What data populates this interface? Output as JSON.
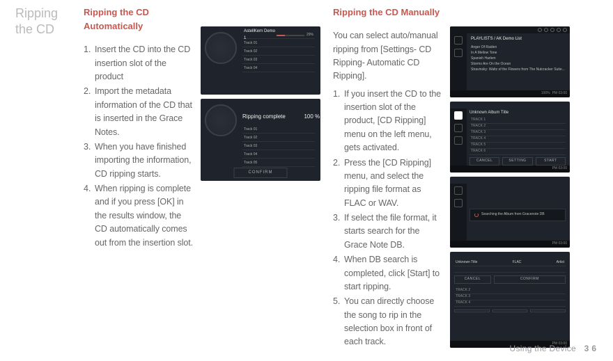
{
  "sidebar_title_line1": "Ripping",
  "sidebar_title_line2": "the CD",
  "auto": {
    "heading": "Ripping the CD Automatically",
    "steps": [
      "Insert the CD into the CD insertion slot of the product",
      "Import the metadata information of the CD that is inserted in the Grace Notes.",
      "When you have finished importing the information, CD ripping starts.",
      "When ripping is complete and if you press [OK] in the results window, the CD automatically comes out from the insertion slot."
    ]
  },
  "manual": {
    "heading": "Ripping the CD Manually",
    "intro": "You can select auto/manual ripping from [Settings- CD Ripping- Automatic CD Ripping].",
    "steps": [
      "If you insert the CD to the insertion slot of the product, [CD Ripping] menu on the left menu, gets activated.",
      "Press the [CD Ripping] menu, and select the ripping file format as FLAC or WAV.",
      "If select the file format, it starts search for the Grace Note DB.",
      "When DB search is completed, click [Start] to start ripping.",
      "You can directly choose the song to rip in the selection box in front of each track."
    ]
  },
  "figures": {
    "auto1": {
      "album_label": "AstellKern Demo 1",
      "progress_pct": "29%",
      "tracks": [
        "Track 01",
        "Track 02",
        "Track 03",
        "Track 04"
      ]
    },
    "auto2": {
      "status_label": "Ripping complete",
      "progress_pct": "100 %",
      "tracks": [
        "Track 01",
        "Track 02",
        "Track 03",
        "Track 04",
        "Track 05"
      ],
      "confirm": "CONFIRM"
    },
    "manual_playlist": {
      "header": "PLAYLISTS / AK Demo List",
      "items": [
        "Anger Of Raiden",
        "In A Mellow Tone",
        "Spanish Harlem",
        "Storms Are On the Ocean",
        "Stravinsky: Waltz of the Flowers from The Nutcracker Suite..."
      ],
      "status_temp": "100%",
      "status_time": "PM 03:00"
    },
    "manual_ripping": {
      "header": "Unknown Album Title",
      "tracks": [
        "TRACK 1",
        "TRACK 2",
        "TRACK 3",
        "TRACK 4",
        "TRACK 5",
        "TRACK 6"
      ],
      "buttons": {
        "cancel": "CANCEL",
        "setting": "SETTING",
        "start": "START"
      },
      "status_time": "PM 03:00"
    },
    "manual_searching": {
      "label": "Searching the Album from Gracenote DB",
      "status_time": "PM 03:00"
    },
    "manual_confirm": {
      "header": "Unknown Title",
      "cols": {
        "c1": "FLAC",
        "c2": "Artist"
      },
      "buttons": {
        "cancel": "CANCEL",
        "confirm": "CONFIRM"
      },
      "tracks": [
        "TRACK 2",
        "TRACK 3",
        "TRACK 4"
      ],
      "status_time": "PM 03:00"
    }
  },
  "footer": {
    "section": "Using the Device",
    "page": "36"
  }
}
